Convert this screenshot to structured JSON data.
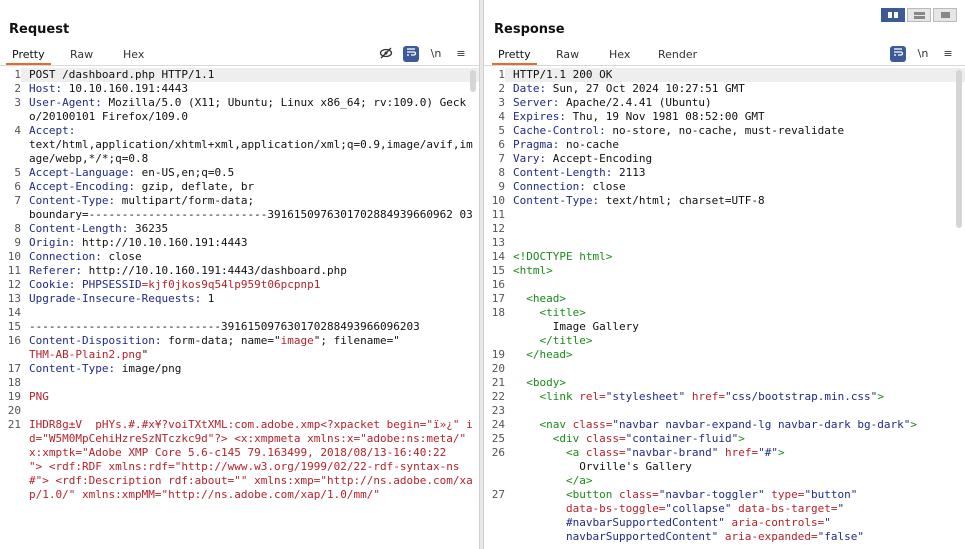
{
  "request": {
    "title": "Request",
    "tabs": [
      "Pretty",
      "Raw",
      "Hex"
    ],
    "tools": {
      "hide_icon": "eye-slash-icon",
      "wrap_icon": "wrap-lines-icon",
      "newline": "\\n",
      "menu": "≡"
    },
    "lines": [
      {
        "n": "1",
        "parts": [
          {
            "t": "POST /dashboard.php HTTP/1.1"
          }
        ]
      },
      {
        "n": "2",
        "parts": [
          {
            "t": "Host:",
            "c": "hk"
          },
          {
            "t": " 10.10.160.191:4443"
          }
        ]
      },
      {
        "n": "3",
        "parts": [
          {
            "t": "User-Agent:",
            "c": "hk"
          },
          {
            "t": " Mozilla/5.0 (X11; Ubuntu; Linux x86_64; rv:109.0) Gecko/20100101 Firefox/109.0"
          }
        ]
      },
      {
        "n": "4",
        "parts": [
          {
            "t": "Accept:",
            "c": "hk"
          },
          {
            "t": "\ntext/html,application/xhtml+xml,application/xml;q=0.9,image/avif,image/webp,*/*;q=0.8"
          }
        ]
      },
      {
        "n": "5",
        "parts": [
          {
            "t": "Accept-Language:",
            "c": "hk"
          },
          {
            "t": " en-US,en;q=0.5"
          }
        ]
      },
      {
        "n": "6",
        "parts": [
          {
            "t": "Accept-Encoding:",
            "c": "hk"
          },
          {
            "t": " gzip, deflate, br"
          }
        ]
      },
      {
        "n": "7",
        "parts": [
          {
            "t": "Content-Type:",
            "c": "hk"
          },
          {
            "t": " multipart/form-data;\nboundary=---------------------------3916150976301702884939660962 03"
          }
        ]
      },
      {
        "n": "8",
        "parts": [
          {
            "t": "Content-Length:",
            "c": "hk"
          },
          {
            "t": " 36235"
          }
        ]
      },
      {
        "n": "9",
        "parts": [
          {
            "t": "Origin:",
            "c": "hk"
          },
          {
            "t": " http://10.10.160.191:4443"
          }
        ]
      },
      {
        "n": "10",
        "parts": [
          {
            "t": "Connection:",
            "c": "hk"
          },
          {
            "t": " close"
          }
        ]
      },
      {
        "n": "11",
        "parts": [
          {
            "t": "Referer:",
            "c": "hk"
          },
          {
            "t": " http://10.10.160.191:4443/dashboard.php"
          }
        ]
      },
      {
        "n": "12",
        "parts": [
          {
            "t": "Cookie:",
            "c": "hk"
          },
          {
            "t": " "
          },
          {
            "t": "PHPSESSID",
            "c": "hk"
          },
          {
            "t": "=",
            "c": "red"
          },
          {
            "t": "kjf0jkos9q54lp959t06pcpnp1",
            "c": "red"
          }
        ]
      },
      {
        "n": "13",
        "parts": [
          {
            "t": "Upgrade-Insecure-Requests:",
            "c": "hk"
          },
          {
            "t": " 1"
          }
        ]
      },
      {
        "n": "14",
        "parts": [
          {
            "t": ""
          }
        ]
      },
      {
        "n": "15",
        "parts": [
          {
            "t": "-----------------------------391615097630170288493966096203"
          }
        ]
      },
      {
        "n": "16",
        "parts": [
          {
            "t": "Content-Disposition:",
            "c": "hk"
          },
          {
            "t": " form-data; name=\""
          },
          {
            "t": "image",
            "c": "red"
          },
          {
            "t": "\"; filename=\"\n"
          },
          {
            "t": "THM-AB-Plain2.png",
            "c": "red"
          },
          {
            "t": "\""
          }
        ]
      },
      {
        "n": "17",
        "parts": [
          {
            "t": "Content-Type:",
            "c": "hk"
          },
          {
            "t": " image/png"
          }
        ]
      },
      {
        "n": "18",
        "parts": [
          {
            "t": ""
          }
        ]
      },
      {
        "n": "19",
        "parts": [
          {
            "t": "PNG",
            "c": "red"
          }
        ]
      },
      {
        "n": "20",
        "parts": [
          {
            "t": ""
          }
        ]
      },
      {
        "n": "21",
        "parts": [
          {
            "t": "IHDR8g±V  pHYs.#.#x¥?voiTXtXML:com.adobe.xmp<?xpacket begin=\"ï»¿\" id=\"W5M0MpCehiHzreSzNTczkc9d\"?> <x:xmpmeta xmlns:x=\"adobe:ns:meta/\" x:xmptk=\"Adobe XMP Core 5.6-c145 79.163499, 2018/08/13-16:40:22        \"> <rdf:RDF xmlns:rdf=\"http://www.w3.org/1999/02/22-rdf-syntax-ns#\"> <rdf:Description rdf:about=\"\" xmlns:xmp=\"http://ns.adobe.com/xap/1.0/\" xmlns:xmpMM=\"http://ns.adobe.com/xap/1.0/mm/\"",
            "c": "red"
          }
        ]
      }
    ]
  },
  "response": {
    "title": "Response",
    "tabs": [
      "Pretty",
      "Raw",
      "Hex",
      "Render"
    ],
    "tools": {
      "wrap_icon": "wrap-lines-icon",
      "newline": "\\n",
      "menu": "≡"
    },
    "lines": [
      {
        "n": "1",
        "parts": [
          {
            "t": "HTTP/1.1 200 OK"
          }
        ]
      },
      {
        "n": "2",
        "parts": [
          {
            "t": "Date:",
            "c": "hk"
          },
          {
            "t": " Sun, 27 Oct 2024 10:27:51 GMT"
          }
        ]
      },
      {
        "n": "3",
        "parts": [
          {
            "t": "Server:",
            "c": "hk"
          },
          {
            "t": " Apache/2.4.41 (Ubuntu)"
          }
        ]
      },
      {
        "n": "4",
        "parts": [
          {
            "t": "Expires:",
            "c": "hk"
          },
          {
            "t": " Thu, 19 Nov 1981 08:52:00 GMT"
          }
        ]
      },
      {
        "n": "5",
        "parts": [
          {
            "t": "Cache-Control:",
            "c": "hk"
          },
          {
            "t": " no-store, no-cache, must-revalidate"
          }
        ]
      },
      {
        "n": "6",
        "parts": [
          {
            "t": "Pragma:",
            "c": "hk"
          },
          {
            "t": " no-cache"
          }
        ]
      },
      {
        "n": "7",
        "parts": [
          {
            "t": "Vary:",
            "c": "hk"
          },
          {
            "t": " Accept-Encoding"
          }
        ]
      },
      {
        "n": "8",
        "parts": [
          {
            "t": "Content-Length:",
            "c": "hk"
          },
          {
            "t": " 2113"
          }
        ]
      },
      {
        "n": "9",
        "parts": [
          {
            "t": "Connection:",
            "c": "hk"
          },
          {
            "t": " close"
          }
        ]
      },
      {
        "n": "10",
        "parts": [
          {
            "t": "Content-Type:",
            "c": "hk"
          },
          {
            "t": " text/html; charset=UTF-8"
          }
        ]
      },
      {
        "n": "11",
        "parts": [
          {
            "t": ""
          }
        ]
      },
      {
        "n": "12",
        "parts": [
          {
            "t": ""
          }
        ]
      },
      {
        "n": "13",
        "parts": [
          {
            "t": ""
          }
        ]
      },
      {
        "n": "14",
        "parts": [
          {
            "t": "<!DOCTYPE html>",
            "c": "tag"
          }
        ]
      },
      {
        "n": "15",
        "parts": [
          {
            "t": "<html>",
            "c": "tag"
          }
        ]
      },
      {
        "n": "16",
        "parts": [
          {
            "t": ""
          }
        ]
      },
      {
        "n": "17",
        "parts": [
          {
            "t": "  "
          },
          {
            "t": "<head>",
            "c": "tag"
          }
        ]
      },
      {
        "n": "18",
        "parts": [
          {
            "t": "    "
          },
          {
            "t": "<title>",
            "c": "tag"
          },
          {
            "t": "\n      Image Gallery\n    "
          },
          {
            "t": "</title>",
            "c": "tag"
          }
        ]
      },
      {
        "n": "19",
        "parts": [
          {
            "t": "  "
          },
          {
            "t": "</head>",
            "c": "tag"
          }
        ]
      },
      {
        "n": "20",
        "parts": [
          {
            "t": ""
          }
        ]
      },
      {
        "n": "21",
        "parts": [
          {
            "t": "  "
          },
          {
            "t": "<body>",
            "c": "tag"
          }
        ]
      },
      {
        "n": "22",
        "parts": [
          {
            "t": "    "
          },
          {
            "t": "<link ",
            "c": "tag"
          },
          {
            "t": "rel=",
            "c": "at"
          },
          {
            "t": "\"stylesheet\"",
            "c": "av"
          },
          {
            "t": " href=",
            "c": "at"
          },
          {
            "t": "\"css/bootstrap.min.css\"",
            "c": "av"
          },
          {
            "t": ">",
            "c": "tag"
          }
        ]
      },
      {
        "n": "23",
        "parts": [
          {
            "t": ""
          }
        ]
      },
      {
        "n": "24",
        "parts": [
          {
            "t": "    "
          },
          {
            "t": "<nav ",
            "c": "tag"
          },
          {
            "t": "class=",
            "c": "at"
          },
          {
            "t": "\"navbar navbar-expand-lg navbar-dark bg-dark\"",
            "c": "av"
          },
          {
            "t": ">",
            "c": "tag"
          }
        ]
      },
      {
        "n": "25",
        "parts": [
          {
            "t": "      "
          },
          {
            "t": "<div ",
            "c": "tag"
          },
          {
            "t": "class=",
            "c": "at"
          },
          {
            "t": "\"container-fluid\"",
            "c": "av"
          },
          {
            "t": ">",
            "c": "tag"
          }
        ]
      },
      {
        "n": "26",
        "parts": [
          {
            "t": "        "
          },
          {
            "t": "<a ",
            "c": "tag"
          },
          {
            "t": "class=",
            "c": "at"
          },
          {
            "t": "\"navbar-brand\"",
            "c": "av"
          },
          {
            "t": " href=",
            "c": "at"
          },
          {
            "t": "\"#\"",
            "c": "av"
          },
          {
            "t": ">",
            "c": "tag"
          },
          {
            "t": "\n          Orville's Gallery\n        "
          },
          {
            "t": "</a>",
            "c": "tag"
          }
        ]
      },
      {
        "n": "27",
        "parts": [
          {
            "t": "        "
          },
          {
            "t": "<button ",
            "c": "tag"
          },
          {
            "t": "class=",
            "c": "at"
          },
          {
            "t": "\"navbar-toggler\"",
            "c": "av"
          },
          {
            "t": " type=",
            "c": "at"
          },
          {
            "t": "\"button\"",
            "c": "av"
          },
          {
            "t": "\n        data-bs-toggle=",
            "c": "at"
          },
          {
            "t": "\"collapse\"",
            "c": "av"
          },
          {
            "t": " data-bs-target=",
            "c": "at"
          },
          {
            "t": "\"\n        #navbarSupportedContent\"",
            "c": "av"
          },
          {
            "t": " aria-controls=",
            "c": "at"
          },
          {
            "t": "\"\n        navbarSupportedContent\"",
            "c": "av"
          },
          {
            "t": " aria-expanded=",
            "c": "at"
          },
          {
            "t": "\"false\"",
            "c": "av"
          }
        ]
      }
    ]
  }
}
